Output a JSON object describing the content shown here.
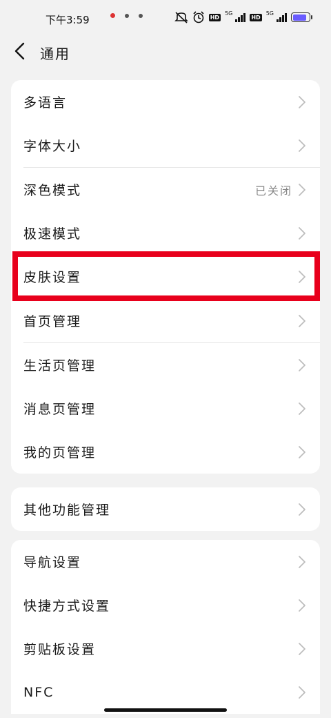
{
  "status_bar": {
    "time": "下午3:59",
    "hd1": "HD",
    "fiveg1": "5G",
    "hd2": "HD",
    "fiveg2": "5G",
    "battery_percent": 85
  },
  "header": {
    "title": "通用"
  },
  "group1": [
    {
      "label": "多语言",
      "value": ""
    },
    {
      "label": "字体大小",
      "value": ""
    },
    {
      "label": "深色模式",
      "value": "已关闭"
    },
    {
      "label": "极速模式",
      "value": ""
    },
    {
      "label": "皮肤设置",
      "value": ""
    },
    {
      "label": "首页管理",
      "value": ""
    },
    {
      "label": "生活页管理",
      "value": ""
    },
    {
      "label": "消息页管理",
      "value": ""
    },
    {
      "label": "我的页管理",
      "value": ""
    }
  ],
  "group2": [
    {
      "label": "其他功能管理",
      "value": ""
    }
  ],
  "group3": [
    {
      "label": "导航设置",
      "value": ""
    },
    {
      "label": "快捷方式设置",
      "value": ""
    },
    {
      "label": "剪贴板设置",
      "value": ""
    },
    {
      "label": "NFC",
      "value": ""
    }
  ],
  "colors": {
    "highlight": "#e8001c",
    "background": "#f2f2f2",
    "card": "#ffffff",
    "secondary_text": "#888888"
  }
}
